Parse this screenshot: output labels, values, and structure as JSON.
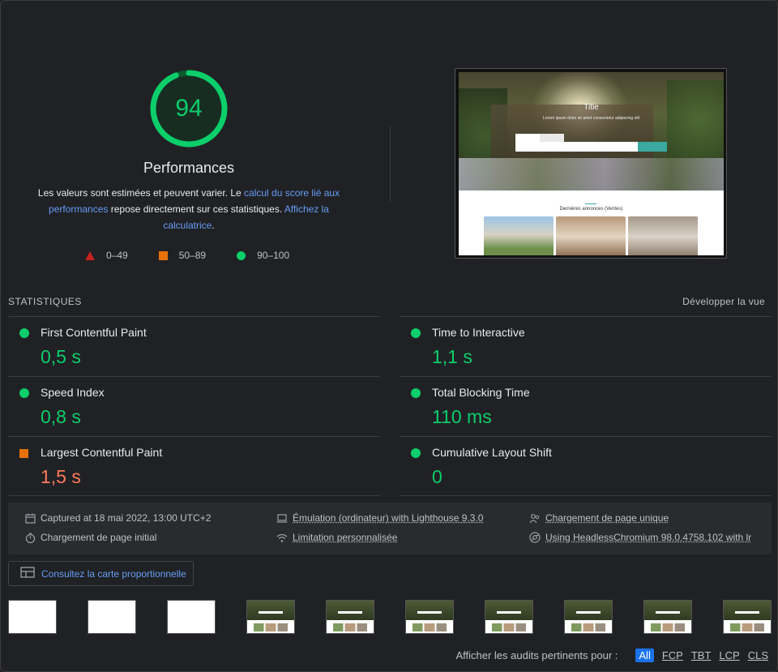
{
  "score": {
    "value": "94",
    "fraction": 0.94,
    "title": "Performances",
    "desc_pre": "Les valeurs sont estimées et peuvent varier. Le ",
    "desc_link1": "calcul du score lié aux performances",
    "desc_mid": " repose directement sur ces statistiques. ",
    "desc_link2": "Affichez la calculatrice",
    "desc_post": "."
  },
  "legend": [
    {
      "shape": "triangle",
      "color": "#c5221f",
      "label": "0–49"
    },
    {
      "shape": "square",
      "color": "#e8710a",
      "label": "50–89"
    },
    {
      "shape": "circle",
      "color": "#0cce6b",
      "label": "90–100"
    }
  ],
  "screenshot": {
    "hero_title": "Title",
    "hero_sub": "Lorem ipsum dolor sit amet consectetur adipiscing elit",
    "section_title": "Dernières annonces (Ventes)"
  },
  "stats": {
    "title": "STATISTIQUES",
    "expand_label": "Développer la vue",
    "metrics": [
      {
        "label": "First Contentful Paint",
        "value": "0,5 s",
        "rating": "pass"
      },
      {
        "label": "Time to Interactive",
        "value": "1,1 s",
        "rating": "pass"
      },
      {
        "label": "Speed Index",
        "value": "0,8 s",
        "rating": "pass"
      },
      {
        "label": "Total Blocking Time",
        "value": "110 ms",
        "rating": "pass"
      },
      {
        "label": "Largest Contentful Paint",
        "value": "1,5 s",
        "rating": "average"
      },
      {
        "label": "Cumulative Layout Shift",
        "value": "0",
        "rating": "pass"
      }
    ]
  },
  "env": {
    "captured": "Captured at 18 mai 2022, 13:00 UTC+2",
    "initial_load": "Chargement de page initial",
    "emulation": "Émulation (ordinateur) with Lighthouse 9.3.0",
    "throttling": "Limitation personnalisée",
    "single_load": "Chargement de page unique",
    "browser": "Using HeadlessChromium 98.0.4758.102 with lr"
  },
  "treemap_label": "Consultez la carte proportionnelle",
  "filmstrip": [
    "blank",
    "blank",
    "blank",
    "loaded",
    "loaded",
    "loaded",
    "loaded",
    "loaded",
    "loaded",
    "loaded"
  ],
  "audit_filter": {
    "label": "Afficher les audits pertinents pour :",
    "options": [
      "All",
      "FCP",
      "TBT",
      "LCP",
      "CLS"
    ]
  },
  "colors": {
    "pass": "#0cce6b",
    "average": "#e8710a",
    "fail": "#c5221f",
    "link": "#669df6"
  }
}
